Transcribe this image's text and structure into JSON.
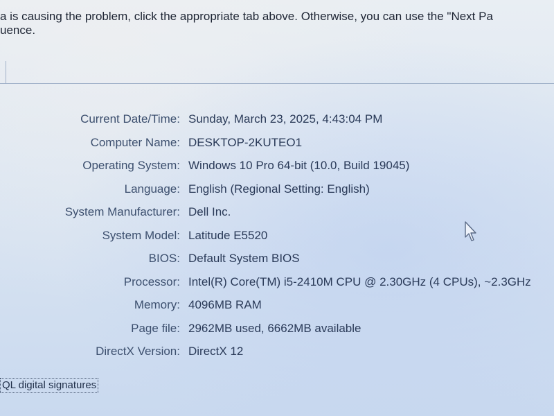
{
  "intro": {
    "line1": "a is causing the problem, click the appropriate tab above.  Otherwise, you can use the \"Next Pa",
    "line2": "uence."
  },
  "system_info": [
    {
      "label": "Current Date/Time:",
      "value": "Sunday, March 23, 2025, 4:43:04 PM"
    },
    {
      "label": "Computer Name:",
      "value": "DESKTOP-2KUTEO1"
    },
    {
      "label": "Operating System:",
      "value": "Windows 10 Pro 64-bit (10.0, Build 19045)"
    },
    {
      "label": "Language:",
      "value": "English (Regional Setting: English)"
    },
    {
      "label": "System Manufacturer:",
      "value": "Dell Inc."
    },
    {
      "label": "System Model:",
      "value": "Latitude E5520"
    },
    {
      "label": "BIOS:",
      "value": "Default System BIOS"
    },
    {
      "label": "Processor:",
      "value": "Intel(R) Core(TM) i5-2410M CPU @ 2.30GHz (4 CPUs), ~2.3GHz"
    },
    {
      "label": "Memory:",
      "value": "4096MB RAM"
    },
    {
      "label": "Page file:",
      "value": "2962MB used, 6662MB available"
    },
    {
      "label": "DirectX Version:",
      "value": "DirectX 12"
    }
  ],
  "checkbox_label": "QL digital signatures",
  "icons": {
    "cursor": "mouse-pointer-icon"
  }
}
